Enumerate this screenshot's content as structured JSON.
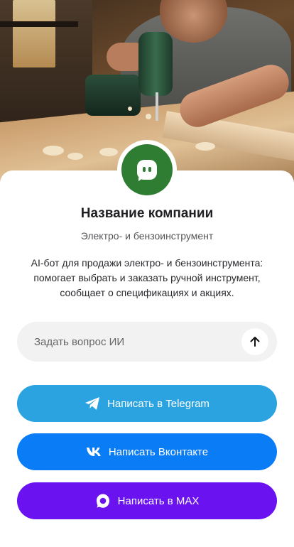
{
  "hero": {
    "image": "man-drilling-wood-workshop-photo"
  },
  "company": {
    "logo_icon": "chat-bot-icon",
    "name": "Название компании",
    "category": "Электро- и бензоинструмент",
    "description": "AI-бот для продажи электро- и бензоинструмента: помогает выбрать и заказать ручной инструмент, сообщает о спецификациях и акциях.",
    "brand_color": "#2e7d32"
  },
  "ask": {
    "placeholder": "Задать вопрос ИИ",
    "send_icon": "arrow-up-icon"
  },
  "buttons": [
    {
      "label": "Написать в Telegram",
      "icon": "telegram-icon",
      "color": "#2aa3e0"
    },
    {
      "label": "Написать Вконтакте",
      "icon": "vk-icon",
      "color": "#0a7cf5"
    },
    {
      "label": "Написать в MAX",
      "icon": "max-icon",
      "color": "#6a12f0"
    }
  ]
}
